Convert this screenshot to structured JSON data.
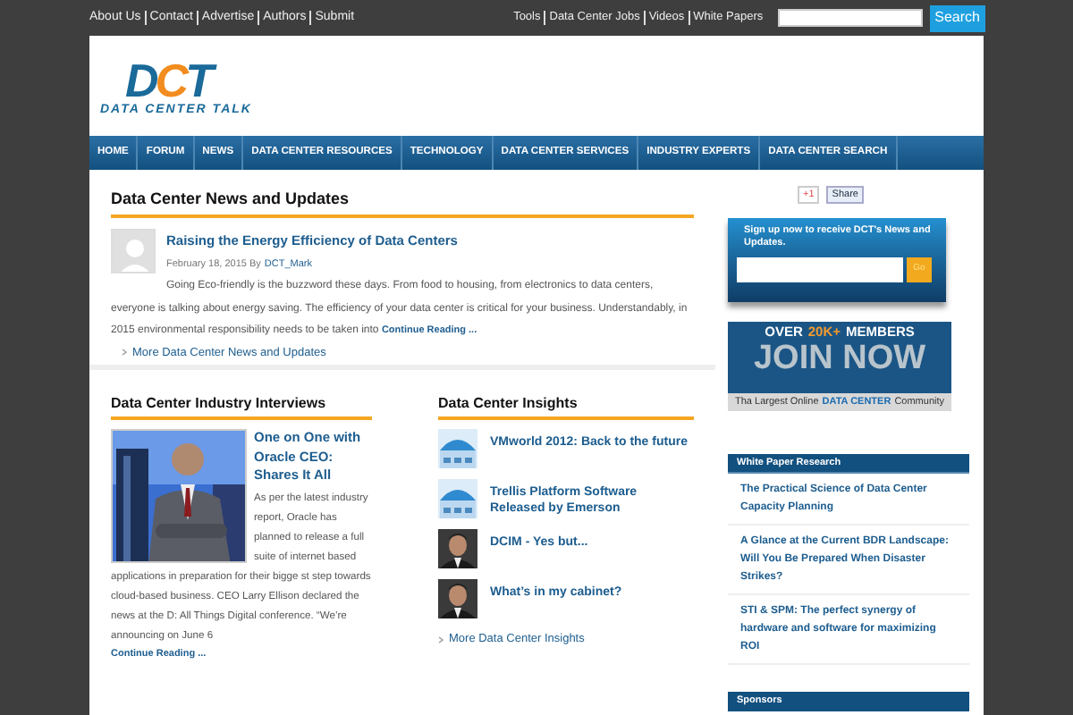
{
  "top_links_left": [
    "About Us",
    "Contact",
    "Advertise",
    "Authors",
    "Submit"
  ],
  "top_links_right": [
    "Tools",
    "Data Center Jobs",
    "Videos",
    "White Papers"
  ],
  "top_search": {
    "button": "Search"
  },
  "logo": {
    "letters": [
      "D",
      "C",
      "T"
    ],
    "tagline": "DATA CENTER TALK"
  },
  "nav": [
    "HOME",
    "FORUM",
    "NEWS",
    "DATA CENTER RESOURCES",
    "TECHNOLOGY",
    "DATA CENTER SERVICES",
    "INDUSTRY EXPERTS",
    "DATA CENTER SEARCH"
  ],
  "news": {
    "heading": "Data Center News and Updates",
    "article": {
      "title": "Raising the Energy Efficiency of Data Centers",
      "date": "February 18, 2015 By",
      "author": "DCT_Mark",
      "body": "Going Eco-friendly is the buzzword these days. From food to housing, from electronics to data centers, everyone is talking about energy saving. The efficiency of your data center is critical for your business. Understandably, in 2015 environmental responsibility needs to be taken into",
      "more": "Continue Reading ..."
    },
    "more_link": "More Data Center News and Updates"
  },
  "interviews": {
    "heading": "Data Center Industry Interviews",
    "title": "One on One with Oracle CEO: Shares It All",
    "body_beside": "As per the latest industry report, Oracle has planned to release a full suite of internet based",
    "body": "applications in preparation for their bigge st step towards cloud-based business. CEO Larry Ellison declared the news at the D: All Things Digital conference. “We’re announcing on June 6",
    "more": "Continue Reading ..."
  },
  "insights": {
    "heading": "Data Center Insights",
    "items": [
      {
        "title": "VMworld 2012: Back to the future",
        "kind": "graphic"
      },
      {
        "title": "Trellis Platform Software Released by Emerson",
        "kind": "graphic"
      },
      {
        "title": "DCIM - Yes but..."
      },
      {
        "title": "What’s in my cabinet?"
      }
    ],
    "more_link": "More Data Center Insights"
  },
  "share": {
    "gplus": "+1",
    "share": "Share"
  },
  "signup": {
    "text": "Sign up now to receive DCT's News and Updates.",
    "button": "Go"
  },
  "join_banner": {
    "over": "OVER",
    "count": "20K+",
    "members": "MEMBERS",
    "join": "JOIN NOW",
    "tagline_a": "Tha Largest Online",
    "tagline_b": "DATA CENTER",
    "tagline_c": "Community"
  },
  "white_papers": {
    "heading": "White Paper Research",
    "items": [
      "The Practical Science of Data Center Capacity Planning",
      "A Glance at the Current BDR Landscape: Will You Be Prepared When Disaster Strikes?",
      "STI & SPM: The perfect synergy of hardware and software for maximizing ROI"
    ]
  },
  "sponsors": {
    "heading": "Sponsors"
  }
}
